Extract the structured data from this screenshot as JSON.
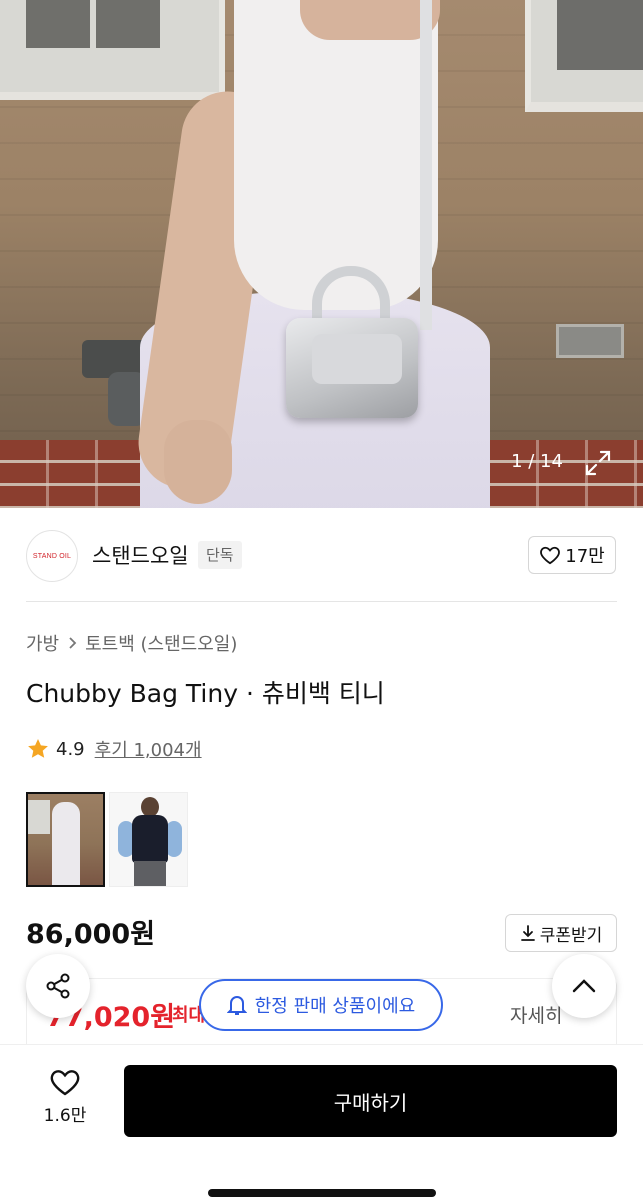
{
  "gallery": {
    "counter": "1 / 14",
    "expand_icon": "expand-icon"
  },
  "store": {
    "logo_text": "STAND OIL",
    "name": "스탠드오일",
    "exclusive_tag": "단독",
    "like_count": "17만"
  },
  "product": {
    "breadcrumb": [
      "가방",
      "토트백 (스탠드오일)"
    ],
    "title": "Chubby Bag Tiny · 츄비백 티니",
    "rating": "4.9",
    "reviews_label": "후기 1,004개",
    "price": "86,000원",
    "coupon_label": "쿠폰받기",
    "max_price": "77,020원",
    "max_label": "최대",
    "detail_label": "자세히"
  },
  "floating": {
    "limited_label": "한정 판매 상품이에요"
  },
  "bottom": {
    "wish_count": "1.6만",
    "buy_label": "구매하기"
  },
  "colors": {
    "accent_red": "#e4232c",
    "pill_blue": "#3868e8",
    "star": "#f5a623",
    "buy_bg": "#000000"
  }
}
